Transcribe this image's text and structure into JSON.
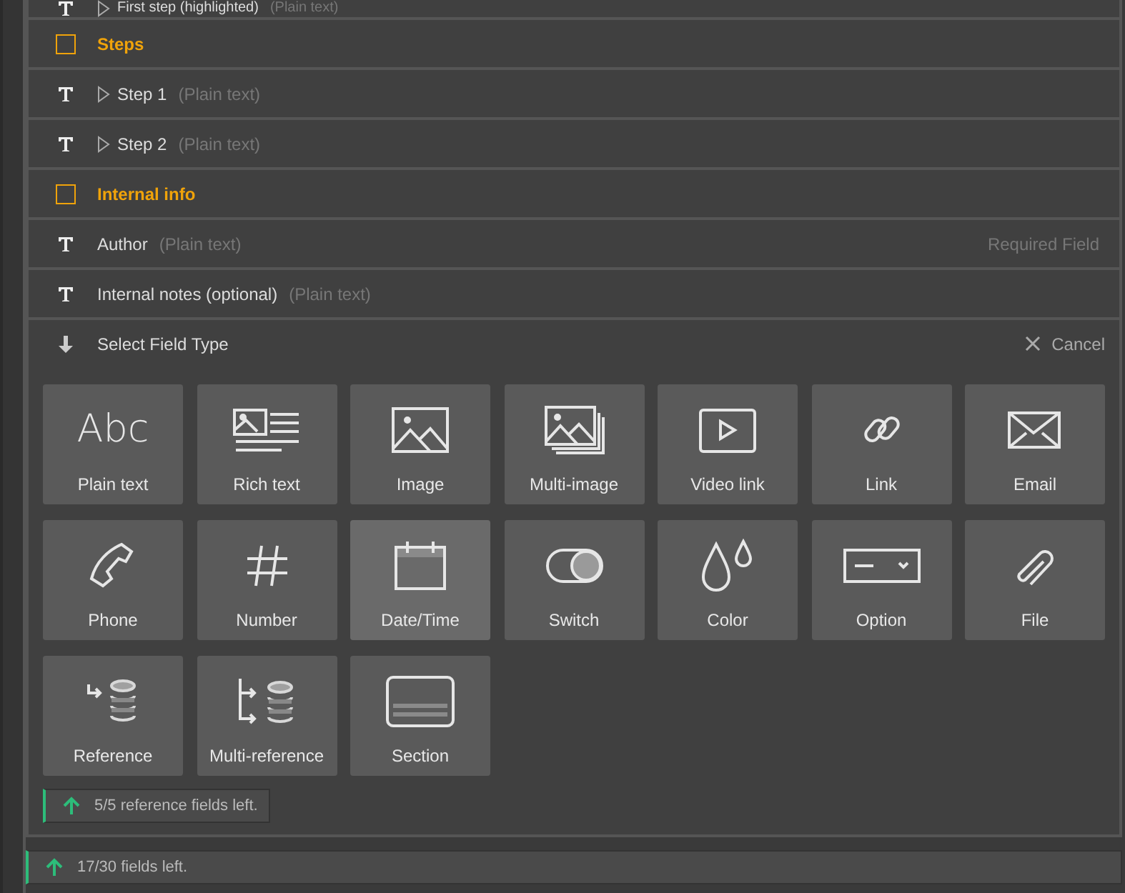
{
  "fields": [
    {
      "kind": "step",
      "label": "First step (highlighted)",
      "type": "(Plain text)",
      "clipped": true
    },
    {
      "kind": "section",
      "label": "Steps",
      "clipped": false
    },
    {
      "kind": "step",
      "label": "Step 1",
      "type": "(Plain text)",
      "clipped": false
    },
    {
      "kind": "step",
      "label": "Step 2",
      "type": "(Plain text)",
      "clipped": false
    },
    {
      "kind": "section",
      "label": "Internal info",
      "clipped": false
    },
    {
      "kind": "field",
      "label": "Author",
      "type": "(Plain text)",
      "note": "Required Field",
      "clipped": false
    },
    {
      "kind": "field",
      "label": "Internal notes (optional)",
      "type": "(Plain text)",
      "clipped": false
    }
  ],
  "picker": {
    "title": "Select Field Type",
    "cancel": "Cancel",
    "types": [
      {
        "kind": "abc",
        "glyph": "Abc",
        "label": "Plain text",
        "selected": false
      },
      {
        "kind": "rich",
        "label": "Rich text",
        "selected": false
      },
      {
        "kind": "image",
        "label": "Image",
        "selected": false
      },
      {
        "kind": "multiimage",
        "label": "Multi-image",
        "selected": false
      },
      {
        "kind": "video",
        "label": "Video link",
        "selected": false
      },
      {
        "kind": "link",
        "label": "Link",
        "selected": false
      },
      {
        "kind": "email",
        "label": "Email",
        "selected": false
      },
      {
        "kind": "phone",
        "label": "Phone",
        "selected": false
      },
      {
        "kind": "number",
        "label": "Number",
        "selected": false
      },
      {
        "kind": "date",
        "label": "Date/Time",
        "selected": true
      },
      {
        "kind": "switch",
        "label": "Switch",
        "selected": false
      },
      {
        "kind": "color",
        "label": "Color",
        "selected": false
      },
      {
        "kind": "option",
        "label": "Option",
        "selected": false
      },
      {
        "kind": "file",
        "label": "File",
        "selected": false
      },
      {
        "kind": "reference",
        "label": "Reference",
        "selected": false
      },
      {
        "kind": "multireference",
        "label": "Multi-reference",
        "selected": false
      },
      {
        "kind": "section",
        "label": "Section",
        "selected": false
      }
    ],
    "reference_info": "5/5 reference fields left."
  },
  "status": "17/30 fields left."
}
